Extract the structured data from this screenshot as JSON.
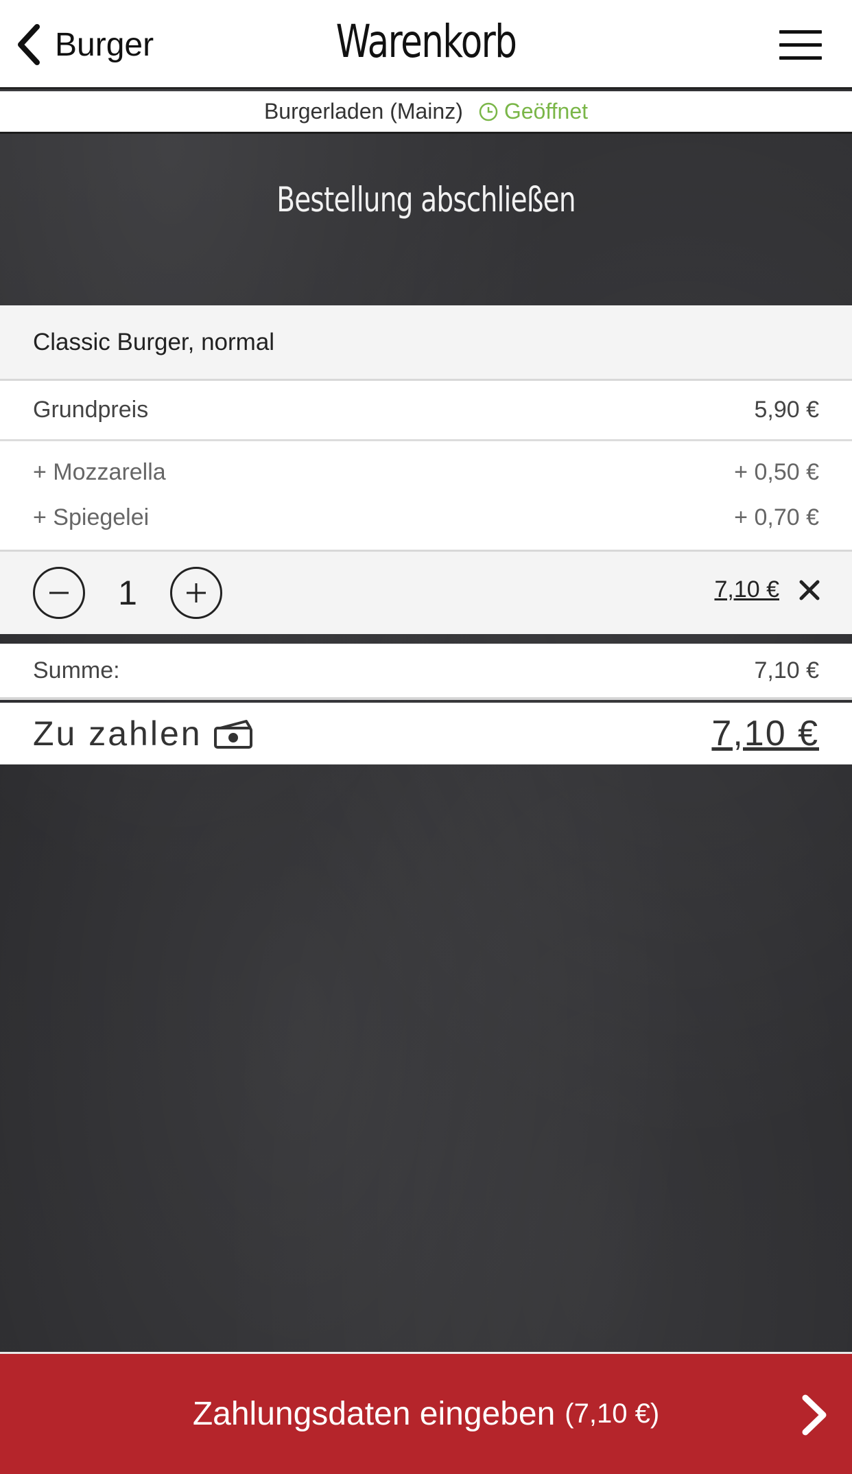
{
  "header": {
    "back_label": "Burger",
    "title": "Warenkorb"
  },
  "store": {
    "name": "Burgerladen (Mainz)",
    "status": "Geöffnet",
    "status_color": "#7ab648"
  },
  "section_title": "Bestellung abschließen",
  "cart": {
    "item_name": "Classic Burger, normal",
    "base_label": "Grundpreis",
    "base_price": "5,90 €",
    "extras": [
      {
        "label": "+ Mozzarella",
        "price": "+ 0,50 €"
      },
      {
        "label": "+ Spiegelei",
        "price": "+ 0,70 €"
      }
    ],
    "quantity": "1",
    "item_total": "7,10 €"
  },
  "summary": {
    "sum_label": "Summe:",
    "sum_value": "7,10 €",
    "pay_label": "Zu zahlen",
    "pay_value": "7,10 €"
  },
  "cta": {
    "label": "Zahlungsdaten eingeben",
    "amount": "(7,10 €)",
    "color": "#b5252b"
  },
  "icons": [
    "back-chevron-icon",
    "menu-icon",
    "clock-icon",
    "minus-icon",
    "plus-icon",
    "close-icon",
    "money-icon",
    "chevron-right-icon"
  ]
}
